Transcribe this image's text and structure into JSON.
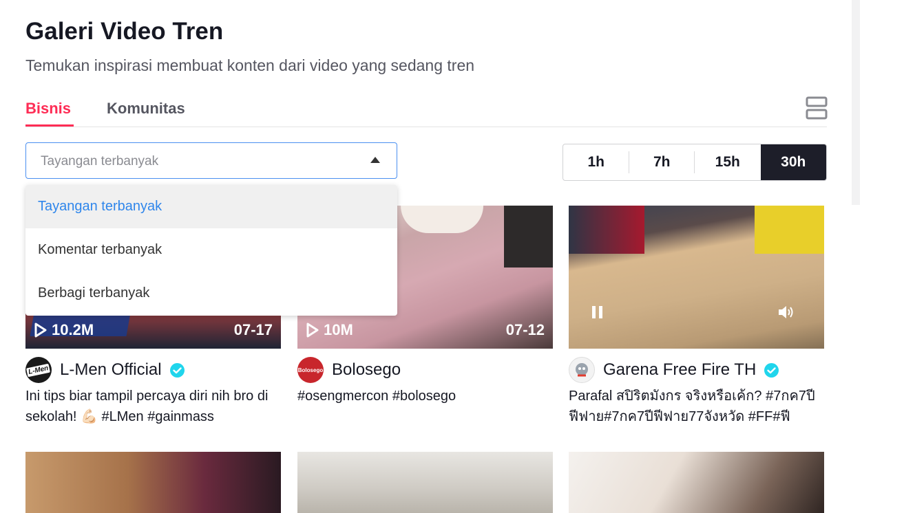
{
  "page": {
    "title": "Galeri Video Tren",
    "subtitle": "Temukan inspirasi membuat konten dari video yang sedang tren"
  },
  "tabs": [
    {
      "label": "Bisnis",
      "active": true
    },
    {
      "label": "Komunitas",
      "active": false
    }
  ],
  "layout_toggle_icon": "list-layout-icon",
  "sort": {
    "selected": "Tayangan terbanyak",
    "options": [
      "Tayangan terbanyak",
      "Komentar terbanyak",
      "Berbagi terbanyak"
    ]
  },
  "time_range": {
    "options": [
      "1h",
      "7h",
      "15h",
      "30h"
    ],
    "active": "30h"
  },
  "videos": [
    {
      "views": "10.2M",
      "date": "07-17",
      "author": "L-Men Official",
      "avatar_text": "L-Men",
      "verified": true,
      "caption": "Ini tips biar tampil percaya diri nih bro di sekolah! 💪🏻 #LMen #gainmass"
    },
    {
      "views": "10M",
      "date": "07-12",
      "author": "Bolosego",
      "avatar_text": "Bolosego",
      "verified": false,
      "caption": "#osengmercon #bolosego"
    },
    {
      "views": "",
      "date": "",
      "author": "Garena Free Fire TH",
      "verified": true,
      "caption": "Parafal สปิริตมังกร จริงหรือเค้ก? #7กค7ปีฟีฟาย#7กค7ปีฟีฟาย77จังหวัด #FF#ฟี",
      "playing": true
    }
  ],
  "colors": {
    "accent": "#fe2c55",
    "selected_option": "#2f86eb",
    "active_range_bg": "#1d1e29",
    "verified": "#20d5ec"
  }
}
